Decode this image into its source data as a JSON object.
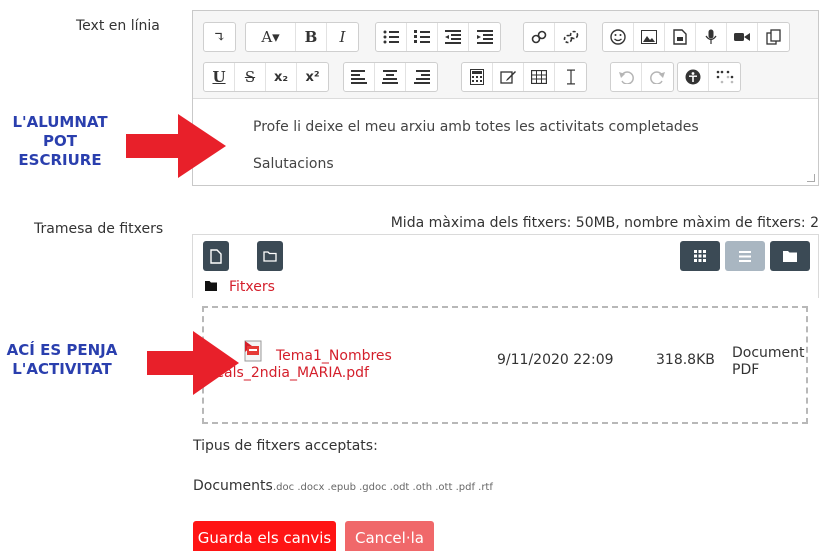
{
  "online_text": {
    "label": "Text en línia",
    "toolbar": {
      "row1": {
        "indent": "↴",
        "font": "A▾",
        "bold": "B",
        "italic": "I"
      },
      "row2": {
        "underline": "U",
        "strike": "S",
        "subscript": "x₂",
        "superscript": "x²"
      }
    },
    "content_lines": [
      "Profe li deixe el meu arxiu amb totes les activitats completades",
      "Salutacions"
    ]
  },
  "annotations": {
    "write_lines": [
      "L'ALUMNAT",
      "POT",
      "ESCRIURE"
    ],
    "upload_lines": [
      "ACÍ ES PENJA",
      "L'ACTIVITAT"
    ],
    "color": "#2a3fae",
    "arrow_color": "#e8202a"
  },
  "file_submission": {
    "label": "Tramesa de fitxers",
    "limits": "Mida màxima dels fitxers: 50MB, nombre màxim de fitxers: 2",
    "breadcrumb": "Fitxers",
    "files": [
      {
        "name_lines": [
          "Tema1_Nombres",
          "reals_2ndia_MARIA.pdf"
        ],
        "date": "9/11/2020 22:09",
        "size": "318.8KB",
        "type_lines": [
          "Document",
          "PDF"
        ]
      }
    ]
  },
  "accepted": {
    "heading": "Tipus de fitxers acceptats:",
    "group_name": "Documents",
    "extensions": ".doc .docx .epub .gdoc .odt .oth .ott .pdf .rtf"
  },
  "actions": {
    "save": "Guarda els canvis",
    "cancel": "Cancel·la"
  },
  "colors": {
    "save": "#ff1414",
    "cancel": "#f0686a",
    "file_link": "#d41f2b",
    "fm_button": "#3b4a55"
  }
}
